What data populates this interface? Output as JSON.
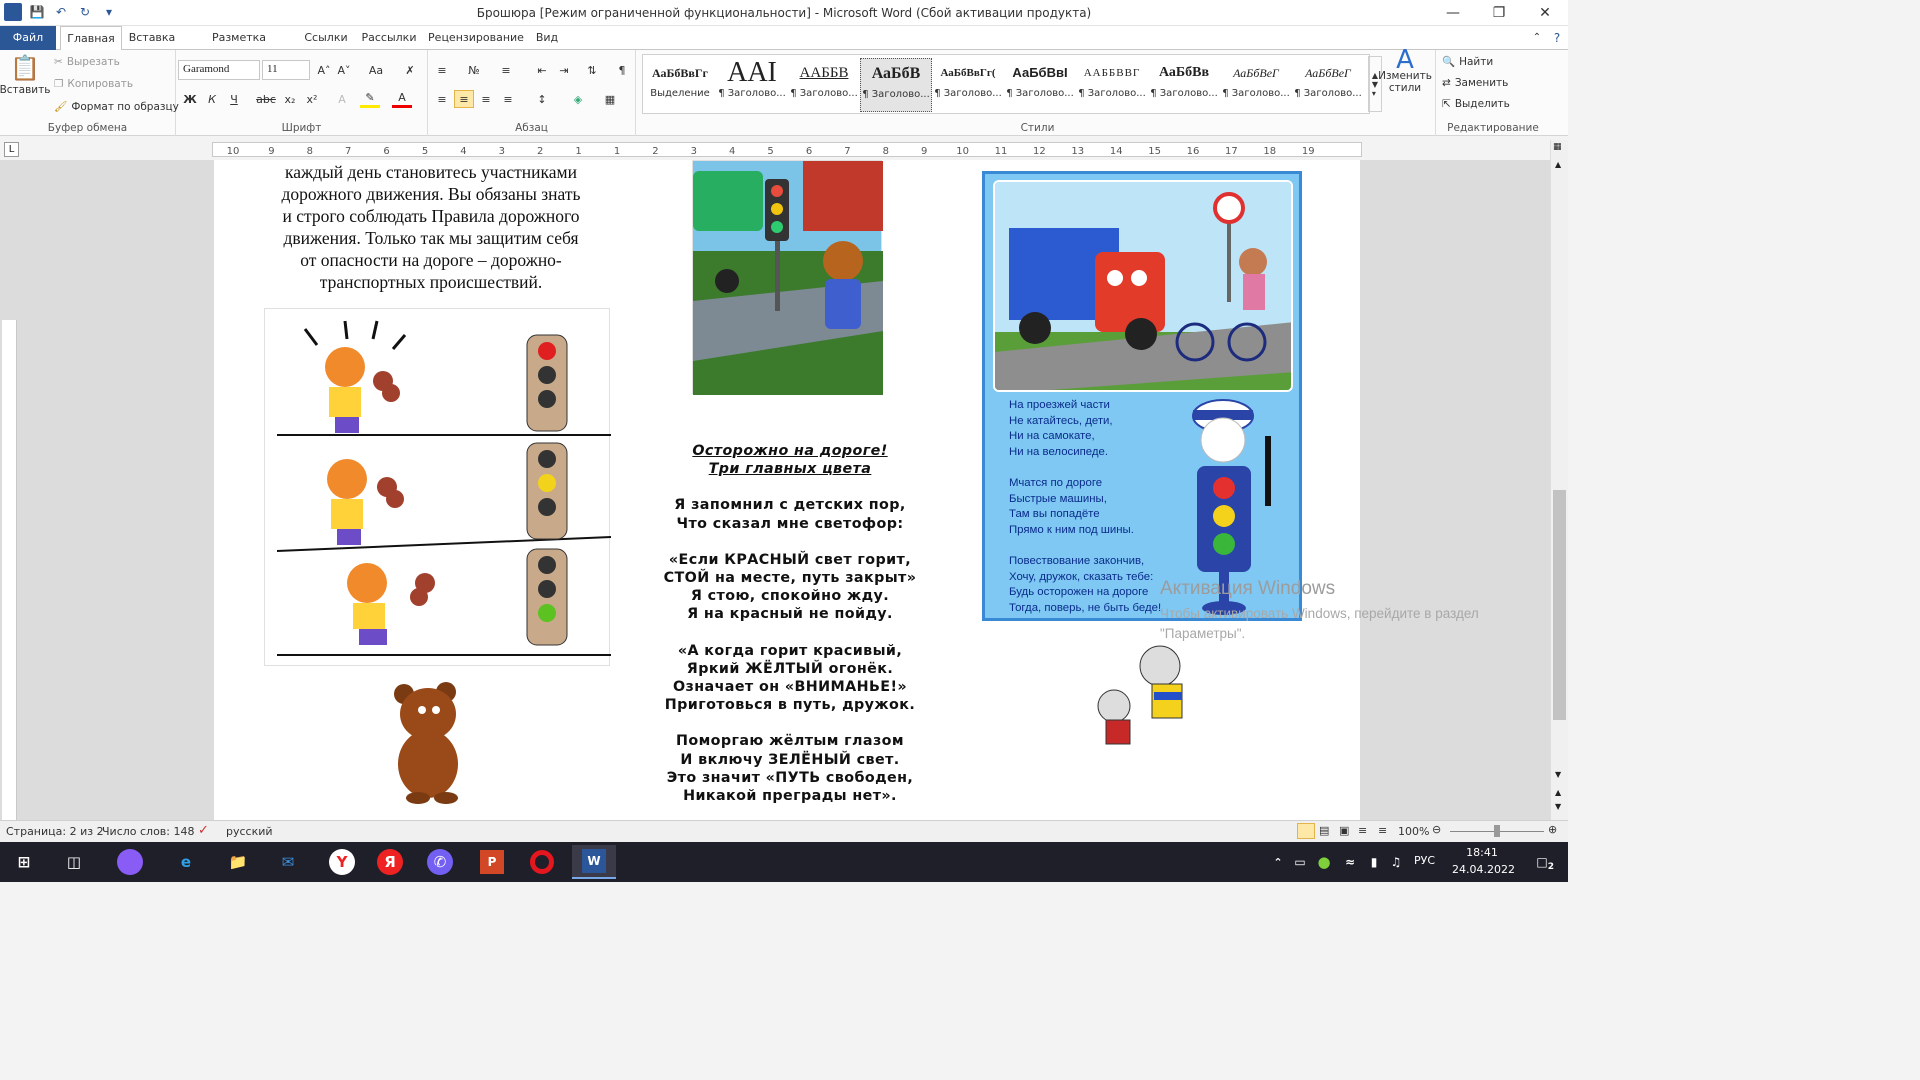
{
  "window": {
    "title": "Брошюра [Режим ограниченной функциональности]  -  Microsoft Word (Сбой активации продукта)"
  },
  "tabs": [
    {
      "label": "Файл"
    },
    {
      "label": "Главная"
    },
    {
      "label": "Вставка"
    },
    {
      "label": "Разметка страницы"
    },
    {
      "label": "Ссылки"
    },
    {
      "label": "Рассылки"
    },
    {
      "label": "Рецензирование"
    },
    {
      "label": "Вид"
    }
  ],
  "ribbon": {
    "clipboard": {
      "paste": "Вставить",
      "cut": "Вырезать",
      "copy": "Копировать",
      "format_painter": "Формат по образцу",
      "label": "Буфер обмена"
    },
    "font": {
      "name": "Garamond",
      "size": "11",
      "label": "Шрифт"
    },
    "paragraph": {
      "label": "Абзац"
    },
    "styles": {
      "label": "Стили",
      "change_styles": "Изменить стили",
      "items": [
        {
          "preview": "АаБбВвГг",
          "name": "Выделение"
        },
        {
          "preview": "AAI",
          "name": "¶ Заголово..."
        },
        {
          "preview": "ААББВ",
          "name": "¶ Заголово..."
        },
        {
          "preview": "АаБбВ",
          "name": "¶ Заголово..."
        },
        {
          "preview": "АаБбВвГг(",
          "name": "¶ Заголово..."
        },
        {
          "preview": "АаБбВвI",
          "name": "¶ Заголово..."
        },
        {
          "preview": "ААББВВГ",
          "name": "¶ Заголово..."
        },
        {
          "preview": "АаБбВв",
          "name": "¶ Заголово..."
        },
        {
          "preview": "АаБбВеГ",
          "name": "¶ Заголово..."
        },
        {
          "preview": "АаБбВеГ",
          "name": "¶ Заголово..."
        }
      ]
    },
    "editing": {
      "label": "Редактирование",
      "find": "Найти",
      "replace": "Заменить",
      "select": "Выделить"
    }
  },
  "ruler": {
    "numbers": [
      "10",
      "9",
      "8",
      "7",
      "6",
      "5",
      "4",
      "3",
      "2",
      "1",
      "1",
      "2",
      "3",
      "4",
      "5",
      "6",
      "7",
      "8",
      "9",
      "10",
      "11",
      "12",
      "13",
      "14",
      "15",
      "16",
      "17",
      "18",
      "19"
    ]
  },
  "document": {
    "left_text": [
      "каждый день становитесь участниками",
      "дорожного  движения. Вы обязаны знать",
      "и строго соблюдать Правила дорожного",
      "движения. Только так мы  защитим себя",
      "от опасности на дороге – дорожно-",
      "транспортных происшествий."
    ],
    "poem_heading": [
      "Осторожно на дороге!",
      "Три главных цвета"
    ],
    "poem_lines": [
      "Я запомнил с детских пор,",
      "Что сказал мне светофор:",
      "",
      "«Если КРАСНЫЙ свет горит,",
      "СТОЙ на месте, путь закрыт»",
      "Я стою, спокойно жду.",
      "Я на красный не пойду.",
      "",
      "«А когда горит красивый,",
      "Яркий ЖЁЛТЫЙ  огонёк.",
      "Означает он «ВНИМАНЬЕ!»",
      "Приготовься в путь, дружок.",
      "",
      "Поморгаю жёлтым глазом",
      "И включу ЗЕЛЁНЫЙ свет.",
      "Это значит «ПУТЬ свободен,",
      "Никакой преграды нет»."
    ],
    "poster_lines": [
      "На проезжей части",
      "Не катайтесь, дети,",
      "Ни на самокате,",
      "Ни на велосипеде.",
      "",
      "Мчатся по дороге",
      "Быстрые машины,",
      "Там вы попадёте",
      "Прямо к ним под шины.",
      "",
      "Повествование закончив,",
      "Хочу, дружок, сказать тебе:",
      "Будь осторожен на дороге",
      "Тогда, поверь, не быть беде!"
    ]
  },
  "activation": {
    "title": "Активация Windows",
    "line1": "Чтобы активировать Windows, перейдите в раздел",
    "line2": "\"Параметры\"."
  },
  "statusbar": {
    "page": "Страница: 2 из 2",
    "words": "Число слов: 148",
    "language": "русский",
    "zoom": "100%"
  },
  "taskbar": {
    "lang": "РУС",
    "time": "18:41",
    "date": "24.04.2022",
    "notifications": "2"
  },
  "colors": {
    "file_tab": "#2b5797",
    "poster_bg": "#7fc8f4",
    "poster_border": "#3a89d4",
    "poster_text": "#0a2c8a"
  }
}
